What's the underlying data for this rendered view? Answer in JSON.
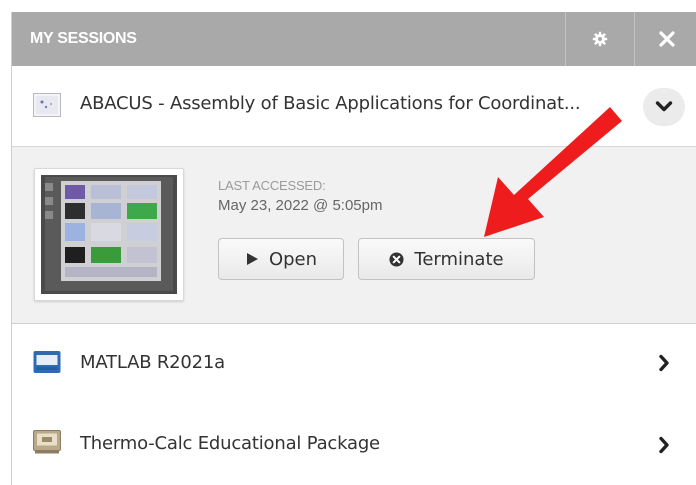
{
  "header": {
    "title": "MY SESSIONS",
    "settings_icon": "gear-icon",
    "close_icon": "close-icon",
    "background": "#a9a9a9"
  },
  "sessions": [
    {
      "name": "ABACUS - Assembly of Basic Applications for Coordinat...",
      "icon": "app-thumbnail-icon",
      "expanded": true,
      "details": {
        "last_accessed_label": "LAST ACCESSED:",
        "last_accessed_value": "May 23, 2022 @ 5:05pm",
        "open_label": "Open",
        "terminate_label": "Terminate"
      }
    },
    {
      "name": "MATLAB R2021a",
      "icon": "monitor-icon",
      "expanded": false
    },
    {
      "name": "Thermo-Calc Educational Package",
      "icon": "computer-icon",
      "expanded": false
    }
  ],
  "annotation": {
    "color": "#ee1c1c",
    "points_to": "terminate-button"
  }
}
